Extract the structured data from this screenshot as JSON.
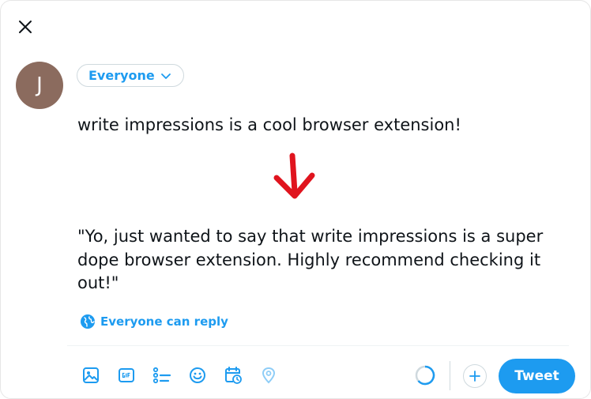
{
  "composer": {
    "avatar_initial": "J",
    "audience_label": "Everyone",
    "draft_text": "write impressions is a cool browser extension!",
    "rewritten_text": "\"Yo, just wanted to say that write impressions is a super dope browser extension. Highly recommend checking it out!\"",
    "reply_setting_label": "Everyone can reply",
    "tweet_button_label": "Tweet"
  },
  "icons": {
    "close": "close-icon",
    "audience_chevron": "chevron-down-icon",
    "arrow": "arrow-down-icon",
    "reply_globe": "globe-icon",
    "toolbar": [
      "image-icon",
      "gif-icon",
      "poll-icon",
      "emoji-icon",
      "schedule-icon",
      "location-icon"
    ],
    "add": "plus-icon"
  },
  "colors": {
    "accent": "#1d9bf0",
    "text": "#0f1419",
    "avatar_bg": "#8b6b5e",
    "arrow": "#e0141e",
    "border": "#cfd9de"
  }
}
